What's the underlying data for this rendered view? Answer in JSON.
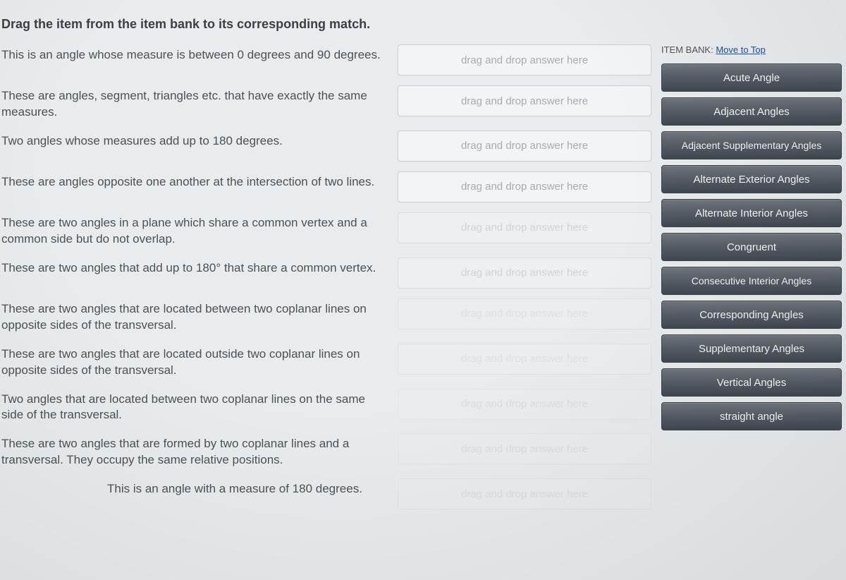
{
  "instruction": "Drag the item from the item bank to its corresponding match.",
  "drop_placeholder": "drag and drop answer here",
  "definitions": [
    "This is an angle whose measure is between 0 degrees and 90 degrees.",
    "These are angles, segment, triangles etc. that have exactly the same measures.",
    "Two angles whose measures add up to 180 degrees.",
    "These are angles opposite one another at the intersection of two lines.",
    "These are two angles in a plane which share a common vertex and a common side but do not overlap.",
    "These are two angles that add up to 180° that share a common vertex.",
    "These are two angles that are located between two coplanar lines on opposite sides of the transversal.",
    "These are two angles that are located outside two coplanar lines on opposite sides of the transversal.",
    "Two angles that are located between two coplanar lines on the same side of the transversal.",
    "These are two angles that are formed by two coplanar lines and a transversal. They occupy the same relative positions.",
    "This is an angle with a measure of 180 degrees."
  ],
  "bank": {
    "label_prefix": "ITEM BANK:",
    "link_text": "Move to Top",
    "items": [
      "Acute Angle",
      "Adjacent Angles",
      "Adjacent Supplementary Angles",
      "Alternate Exterior Angles",
      "Alternate Interior Angles",
      "Congruent",
      "Consecutive Interior Angles",
      "Corresponding Angles",
      "Supplementary Angles",
      "Vertical Angles",
      "straight angle"
    ]
  }
}
